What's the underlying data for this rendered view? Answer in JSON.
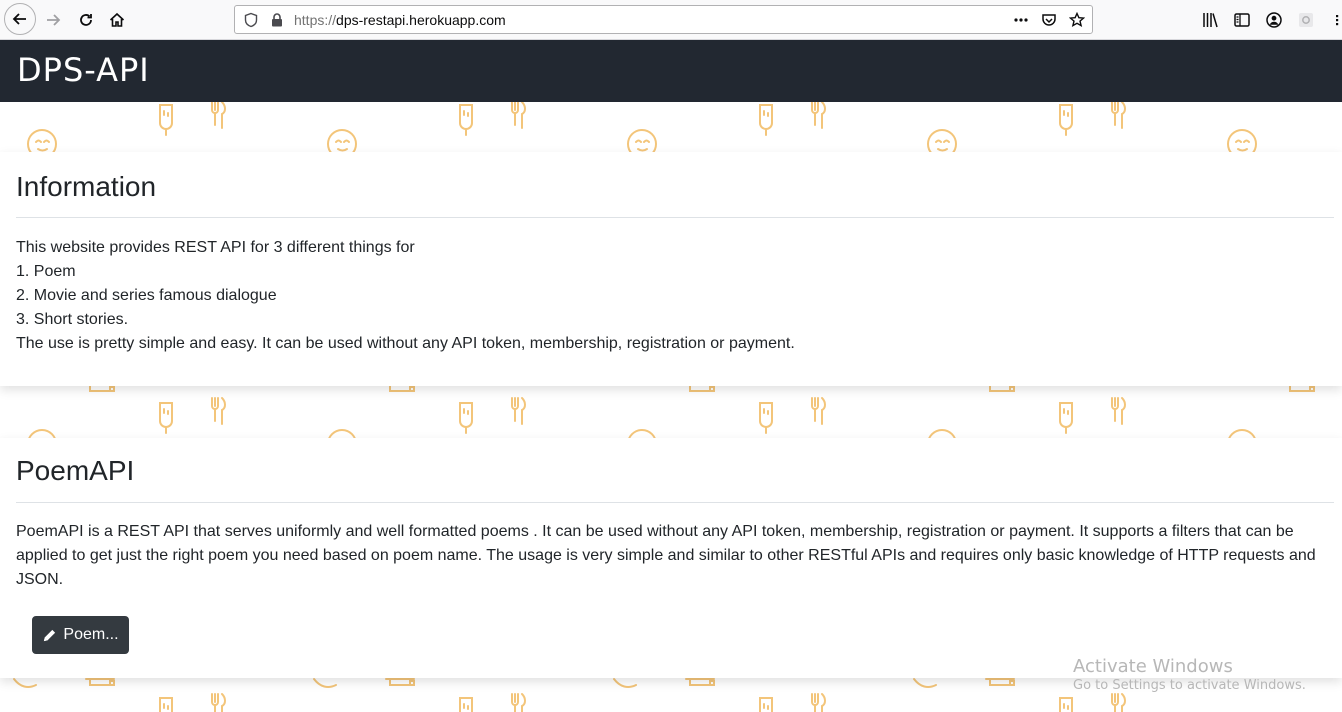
{
  "browser": {
    "url_scheme": "https://",
    "url_host": "dps-restapi.herokuapp.com",
    "page_actions_icon": "more-dots-icon"
  },
  "navbar": {
    "brand": "DPS-API"
  },
  "information": {
    "title": "Information",
    "lines": [
      "This website provides REST API for 3 different things for",
      "1. Poem",
      "2. Movie and series famous dialogue",
      "3. Short stories.",
      "The use is pretty simple and easy. It can be used without any API token, membership, registration or payment."
    ]
  },
  "poem_api": {
    "title": "PoemAPI",
    "description": "PoemAPI is a REST API that serves uniformly and well formatted poems . It can be used without any API token, membership, registration or payment. It supports a filters that can be applied to get just the right poem you need based on poem name. The usage is very simple and similar to other RESTful APIs and requires only basic knowledge of HTTP requests and JSON.",
    "button_label": "Poem..."
  },
  "watermark": {
    "line1": "Activate Windows",
    "line2": "Go to Settings to activate Windows."
  },
  "colors": {
    "navbar_bg": "#222831",
    "button_bg": "#343a40",
    "motif": "#f5c26b"
  }
}
